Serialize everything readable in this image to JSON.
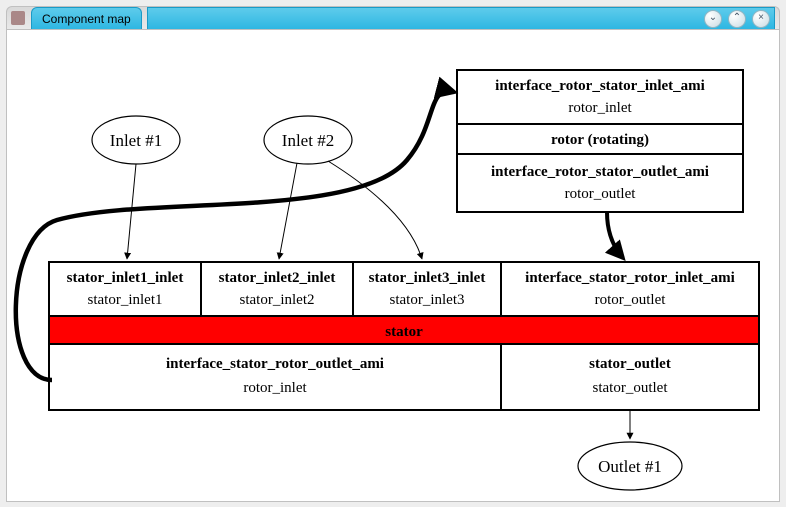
{
  "window": {
    "title": "Component map"
  },
  "inlets": {
    "i1": "Inlet #1",
    "i2": "Inlet #2"
  },
  "outlets": {
    "o1": "Outlet #1"
  },
  "rotor_block": {
    "row1": {
      "title": "interface_rotor_stator_inlet_ami",
      "sub": "rotor_inlet"
    },
    "row2": {
      "title": "rotor (rotating)"
    },
    "row3": {
      "title": "interface_rotor_stator_outlet_ami",
      "sub": "rotor_outlet"
    }
  },
  "stator_block": {
    "top_cells": {
      "c1": {
        "title": "stator_inlet1_inlet",
        "sub": "stator_inlet1"
      },
      "c2": {
        "title": "stator_inlet2_inlet",
        "sub": "stator_inlet2"
      },
      "c3": {
        "title": "stator_inlet3_inlet",
        "sub": "stator_inlet3"
      },
      "c4": {
        "title": "interface_stator_rotor_inlet_ami",
        "sub": "rotor_outlet"
      }
    },
    "mid": {
      "title": "stator"
    },
    "bot_cells": {
      "c1": {
        "title": "interface_stator_rotor_outlet_ami",
        "sub": "rotor_inlet"
      },
      "c2": {
        "title": "stator_outlet",
        "sub": "stator_outlet"
      }
    }
  }
}
